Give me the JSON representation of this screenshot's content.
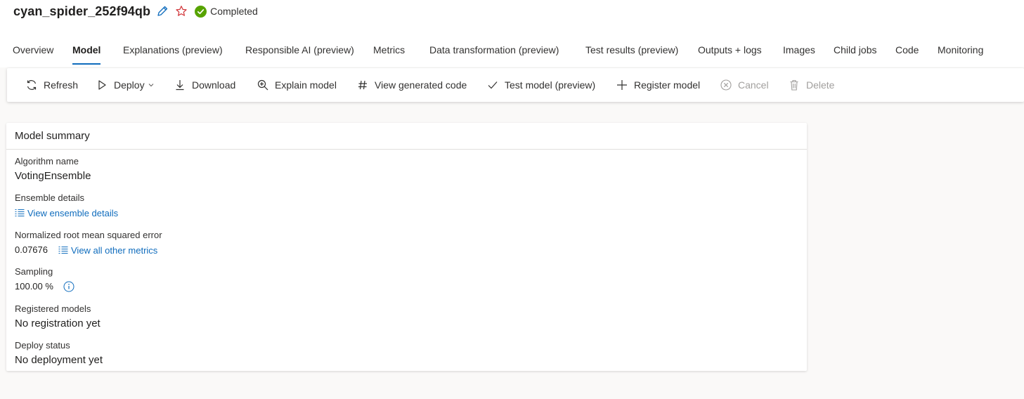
{
  "header": {
    "job_title": "cyan_spider_252f94qb",
    "status": "Completed",
    "colors": {
      "accent": "#0f6cbd",
      "success": "#57a300",
      "star": "#d13438"
    }
  },
  "tabs": [
    {
      "label": "Overview",
      "active": false
    },
    {
      "label": "Model",
      "active": true
    },
    {
      "label": "Explanations (preview)",
      "active": false
    },
    {
      "label": "Responsible AI (preview)",
      "active": false
    },
    {
      "label": "Metrics",
      "active": false
    },
    {
      "label": "Data transformation (preview)",
      "active": false
    },
    {
      "label": "Test results (preview)",
      "active": false
    },
    {
      "label": "Outputs + logs",
      "active": false
    },
    {
      "label": "Images",
      "active": false
    },
    {
      "label": "Child jobs",
      "active": false
    },
    {
      "label": "Code",
      "active": false
    },
    {
      "label": "Monitoring",
      "active": false
    }
  ],
  "toolbar": {
    "refresh": "Refresh",
    "deploy": "Deploy",
    "download": "Download",
    "explain": "Explain model",
    "view_code": "View generated code",
    "test_model": "Test model (preview)",
    "register": "Register model",
    "cancel": "Cancel",
    "delete": "Delete"
  },
  "summary": {
    "title": "Model summary",
    "algorithm_label": "Algorithm name",
    "algorithm_value": "VotingEnsemble",
    "ensemble_label": "Ensemble details",
    "ensemble_link": "View ensemble details",
    "nrmse_label": "Normalized root mean squared error",
    "nrmse_value": "0.07676",
    "metrics_link": "View all other metrics",
    "sampling_label": "Sampling",
    "sampling_value": "100.00 %",
    "registered_label": "Registered models",
    "registered_value": "No registration yet",
    "deploy_label": "Deploy status",
    "deploy_value": "No deployment yet"
  }
}
